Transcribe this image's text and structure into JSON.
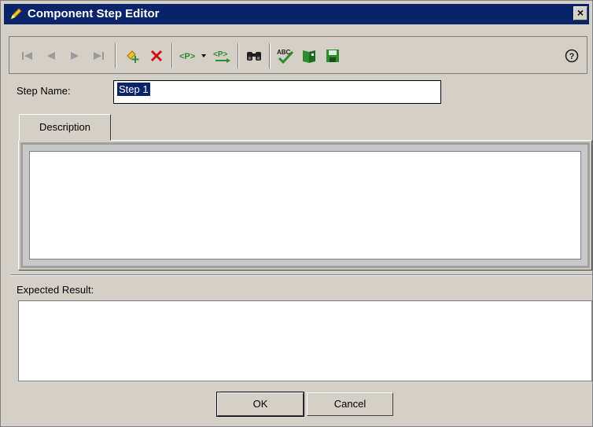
{
  "window": {
    "title": "Component Step Editor",
    "close_label": "×"
  },
  "toolbar": {
    "icons": [
      "first-record-icon",
      "previous-record-icon",
      "next-record-icon",
      "last-record-icon",
      "add-step-icon",
      "delete-step-icon",
      "insert-parameter-icon",
      "parameter-dropdown-icon",
      "parameter-next-icon",
      "find-icon",
      "spell-check-icon",
      "thesaurus-icon",
      "save-icon",
      "help-icon"
    ]
  },
  "form": {
    "step_name_label": "Step Name:",
    "step_name_value": "Step 1",
    "description_tab": "Description",
    "expected_result_label": "Expected Result:"
  },
  "buttons": {
    "ok": "OK",
    "cancel": "Cancel"
  },
  "colors": {
    "titlebar": "#0a246a",
    "dialog": "#d4d0c8",
    "delete_red": "#d01010",
    "green": "#2e8b2e"
  }
}
